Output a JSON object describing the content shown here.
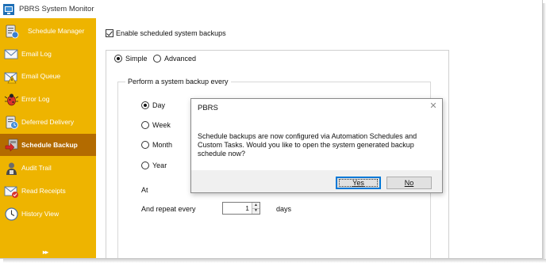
{
  "window": {
    "title": "PBRS System Monitor"
  },
  "sidebar": {
    "items": [
      {
        "label": "Schedule Manager",
        "icon": "schedule-manager-icon",
        "active": false
      },
      {
        "label": "Email Log",
        "icon": "email-log-icon",
        "active": false
      },
      {
        "label": "Email Queue",
        "icon": "email-queue-icon",
        "active": false
      },
      {
        "label": "Error Log",
        "icon": "error-log-icon",
        "active": false
      },
      {
        "label": "Deferred Delivery",
        "icon": "deferred-delivery-icon",
        "active": false
      },
      {
        "label": "Schedule Backup",
        "icon": "schedule-backup-icon",
        "active": true
      },
      {
        "label": "Audit Trail",
        "icon": "audit-trail-icon",
        "active": false
      },
      {
        "label": "Read Receipts",
        "icon": "read-receipts-icon",
        "active": false
      },
      {
        "label": "History View",
        "icon": "history-view-icon",
        "active": false
      }
    ],
    "expander": "▸▸"
  },
  "main": {
    "enable_checkbox": {
      "label": "Enable scheduled system backups",
      "checked": true
    },
    "mode": {
      "simple_label": "Simple",
      "advanced_label": "Advanced",
      "selected": "Simple"
    },
    "backup_group": {
      "caption": "Perform a system backup every",
      "options": [
        {
          "label": "Day",
          "selected": true
        },
        {
          "label": "Week",
          "selected": false
        },
        {
          "label": "Month",
          "selected": false
        },
        {
          "label": "Year",
          "selected": false
        }
      ],
      "at_label": "At",
      "repeat_label": "And repeat every",
      "repeat_value": "1",
      "repeat_unit": "days"
    }
  },
  "dialog": {
    "title": "PBRS",
    "message": "Schedule backups are now configured via Automation Schedules and Custom Tasks. Would you like to open the system generated backup schedule now?",
    "yes_label": "Yes",
    "no_label": "No"
  },
  "colors": {
    "sidebar_bg": "#eeb400",
    "sidebar_active": "#b36b00",
    "accent": "#0078d7"
  }
}
